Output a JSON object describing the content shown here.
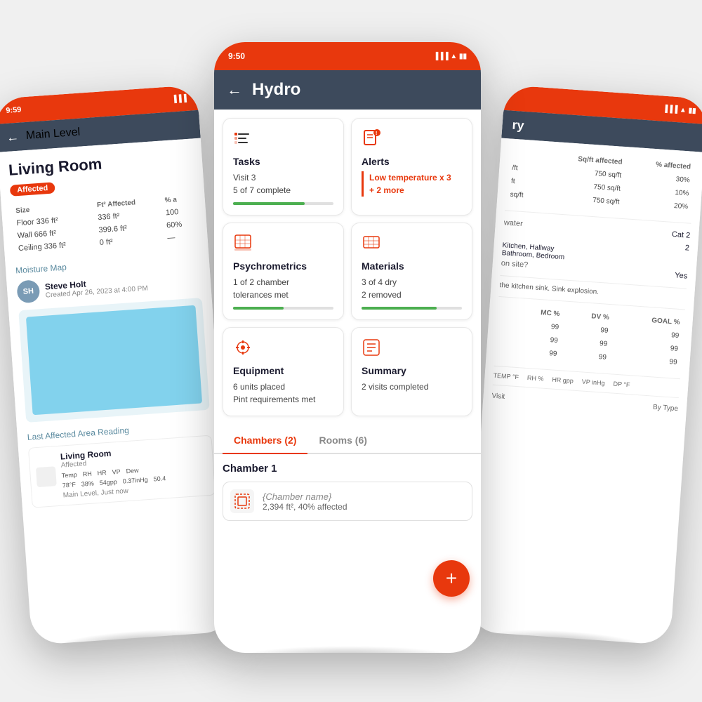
{
  "left_phone": {
    "status_time": "9:59",
    "nav_title": "Main Level",
    "room_title": "Living Room",
    "affected_label": "Affected",
    "size_section": {
      "headers": [
        "",
        "Ft² Affected",
        "% a"
      ],
      "rows": [
        [
          "Floor 336 ft²",
          "336 ft²",
          "100"
        ],
        [
          "Wall 666 ft²",
          "399.6 ft²",
          "60%"
        ],
        [
          "Ceiling 336 ft²",
          "0 ft²",
          "—"
        ]
      ]
    },
    "moisture_map_label": "Moisture Map",
    "user_name": "Steve Holt",
    "user_initials": "SH",
    "user_date": "Created Apr 26, 2023 at 4:00 PM",
    "last_reading_label": "Last Affected Area Reading",
    "reading_room": "Living Room",
    "reading_status": "Affected",
    "reading_metrics": [
      "Temp",
      "RH",
      "HR",
      "VP",
      "Dew"
    ],
    "reading_values": [
      "78°F",
      "38%",
      "54gpp",
      "0.37inHg",
      "50.4"
    ],
    "reading_time": "Main Level, Just now"
  },
  "center_phone": {
    "status_time": "9:50",
    "page_title": "Hydro",
    "back_arrow": "←",
    "cards": [
      {
        "id": "tasks",
        "title": "Tasks",
        "line1": "Visit 3",
        "line2": "5 of 7 complete",
        "progress": 71,
        "icon": "tasks"
      },
      {
        "id": "alerts",
        "title": "Alerts",
        "alert_line1": "Low temperature x 3",
        "alert_line2": "+ 2 more",
        "icon": "alerts"
      },
      {
        "id": "psychrometrics",
        "title": "Psychrometrics",
        "line1": "1 of 2 chamber",
        "line2": "tolerances met",
        "progress": 50,
        "icon": "psychrometrics"
      },
      {
        "id": "materials",
        "title": "Materials",
        "line1": "3 of 4 dry",
        "line2": "2 removed",
        "progress": 75,
        "icon": "materials"
      },
      {
        "id": "equipment",
        "title": "Equipment",
        "line1": "6 units placed",
        "line2": "Pint requirements met",
        "icon": "equipment"
      },
      {
        "id": "summary",
        "title": "Summary",
        "line1": "2 visits completed",
        "icon": "summary"
      }
    ],
    "tabs": [
      {
        "label": "Chambers (2)",
        "active": true
      },
      {
        "label": "Rooms (6)",
        "active": false
      }
    ],
    "chamber_label": "Chamber 1",
    "chamber_name": "{Chamber name}",
    "chamber_size": "2,394 ft², 40% affected",
    "fab_label": "+"
  },
  "right_phone": {
    "status_time": "",
    "nav_title": "ry",
    "section_title": "ry",
    "table_headers": [
      "",
      "Sq/ft affected",
      "% affected"
    ],
    "table_rows": [
      [
        "/ft",
        "750 sq/ft",
        "30%"
      ],
      [
        "ft",
        "750 sq/ft",
        "10%"
      ],
      [
        "sq/ft",
        "750 sq/ft",
        "20%"
      ]
    ],
    "info_rows": [
      {
        "label": "water",
        "value": "Cat 2"
      },
      {
        "label": "",
        "value": "2"
      },
      {
        "label": "Kitchen, Hallway",
        "value": ""
      },
      {
        "label": "Bathroom, Bedroom",
        "value": ""
      },
      {
        "label": "on site?",
        "value": "Yes"
      }
    ],
    "note": "the kitchen sink. Sink explosion.",
    "readings_headers": [
      "",
      "MC %",
      "DV %",
      "GOAL %"
    ],
    "readings_rows": [
      [
        "",
        "99",
        "99",
        "99"
      ],
      [
        "",
        "99",
        "99",
        "99"
      ],
      [
        "",
        "99",
        "99",
        "99"
      ]
    ],
    "temp_headers": [
      "TEMP °F",
      "RH %",
      "HR gpp",
      "VP inHg",
      "DP °F"
    ],
    "chart_labels": [
      "Visit",
      "By Type"
    ]
  }
}
